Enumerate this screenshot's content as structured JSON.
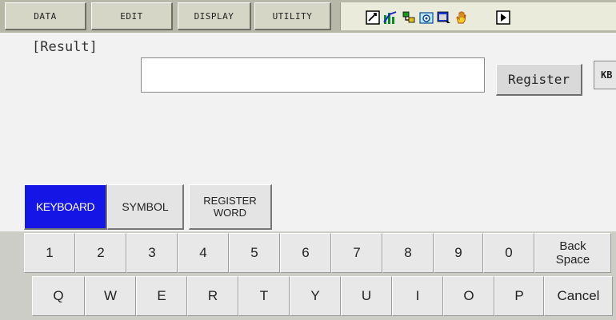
{
  "menubar": {
    "tabs": [
      {
        "id": "data",
        "label": "DATA"
      },
      {
        "id": "edit",
        "label": "EDIT"
      },
      {
        "id": "display",
        "label": "DISPLAY"
      },
      {
        "id": "utility",
        "label": "UTILITY"
      }
    ],
    "status_icons": [
      "edit-mode-icon",
      "chart-icon",
      "network-icon",
      "camera-icon",
      "window-icon",
      "hand-icon",
      "play-icon"
    ]
  },
  "input": {
    "label": "[Result]",
    "value": "",
    "register_label": "Register",
    "kb_label": "KB"
  },
  "modes": [
    {
      "id": "keyboard",
      "label": "KEYBOARD",
      "active": true
    },
    {
      "id": "symbol",
      "label": "SYMBOL",
      "active": false
    },
    {
      "id": "register-word",
      "label": "REGISTER WORD",
      "active": false
    }
  ],
  "keys": {
    "row1": [
      "1",
      "2",
      "3",
      "4",
      "5",
      "6",
      "7",
      "8",
      "9",
      "0",
      "Back Space"
    ],
    "row2": [
      "Q",
      "W",
      "E",
      "R",
      "T",
      "Y",
      "U",
      "I",
      "O",
      "P",
      "Cancel"
    ]
  },
  "colors": {
    "active_tab": "#1515e6",
    "menubar": "#b8b8a8"
  }
}
